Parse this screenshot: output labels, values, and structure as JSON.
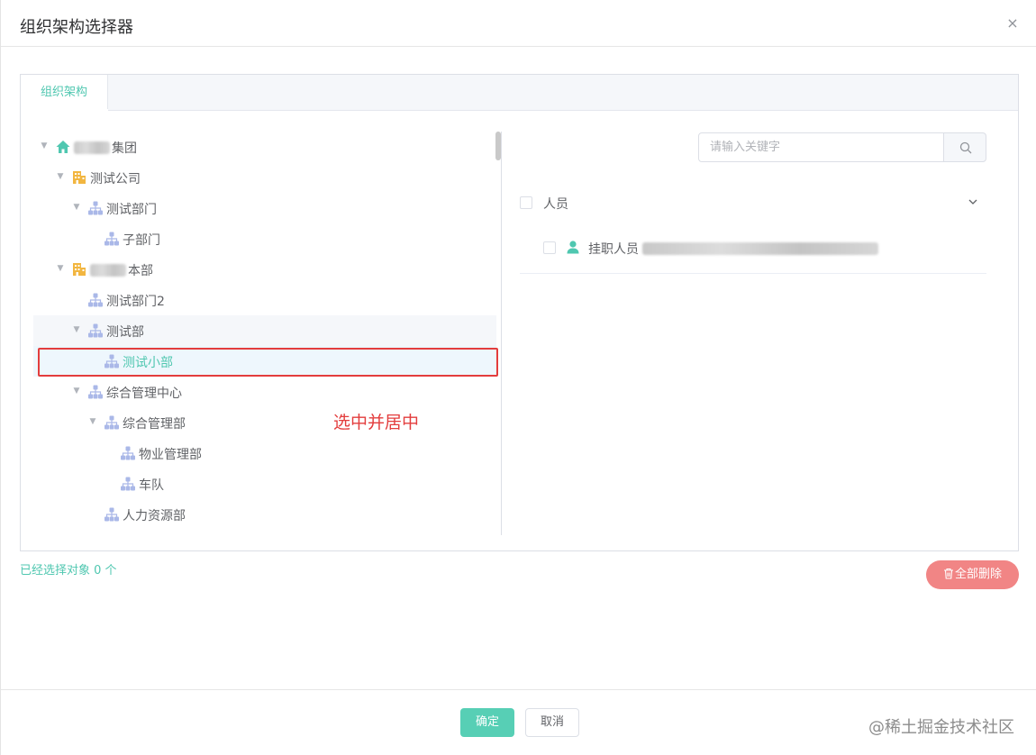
{
  "dialog": {
    "title": "组织架构选择器",
    "close_icon": "×"
  },
  "tabs": [
    {
      "label": "组织架构",
      "active": true
    }
  ],
  "tree": {
    "nodes": [
      {
        "label": "集团",
        "level": 0,
        "expanded": true,
        "icon": "home-icon",
        "redacted_prefix": true
      },
      {
        "label": "测试公司",
        "level": 1,
        "expanded": true,
        "icon": "building-icon"
      },
      {
        "label": "测试部门",
        "level": 2,
        "expanded": true,
        "icon": "org-icon"
      },
      {
        "label": "子部门",
        "level": 3,
        "leaf": true,
        "icon": "org-icon"
      },
      {
        "label": "本部",
        "level": 1,
        "expanded": true,
        "icon": "building-icon",
        "redacted_prefix": true
      },
      {
        "label": "测试部门2",
        "level": 2,
        "leaf": true,
        "icon": "org-icon"
      },
      {
        "label": "测试部",
        "level": 2,
        "expanded": true,
        "icon": "org-icon",
        "hover": true
      },
      {
        "label": "测试小部",
        "level": 3,
        "leaf": true,
        "icon": "org-icon",
        "current": true
      },
      {
        "label": "综合管理中心",
        "level": 2,
        "expanded": true,
        "icon": "org-icon"
      },
      {
        "label": "综合管理部",
        "level": 3,
        "expanded": true,
        "icon": "org-icon"
      },
      {
        "label": "物业管理部",
        "level": 4,
        "leaf": true,
        "icon": "org-icon"
      },
      {
        "label": "车队",
        "level": 4,
        "leaf": true,
        "icon": "org-icon"
      },
      {
        "label": "人力资源部",
        "level": 3,
        "leaf": true,
        "icon": "org-icon"
      }
    ]
  },
  "annotation": "选中并居中",
  "search": {
    "placeholder": "请输入关键字",
    "value": ""
  },
  "people": {
    "group_label": "人员",
    "group_checked": false,
    "items": [
      {
        "label": "挂职人员",
        "checked": false,
        "redacted_suffix": true
      }
    ]
  },
  "selection": {
    "count_text": "已经选择对象 0 个"
  },
  "actions": {
    "delete_all_label": "全部删除",
    "ok_label": "确定",
    "cancel_label": "取消"
  },
  "watermark": "@稀土掘金技术社区",
  "colors": {
    "accent": "#4fc7b0",
    "danger": "#f18585",
    "annotation": "#e33d3d",
    "org_icon": "#aab8e8",
    "building_icon": "#f2b640",
    "home_icon": "#4fc7b0"
  }
}
